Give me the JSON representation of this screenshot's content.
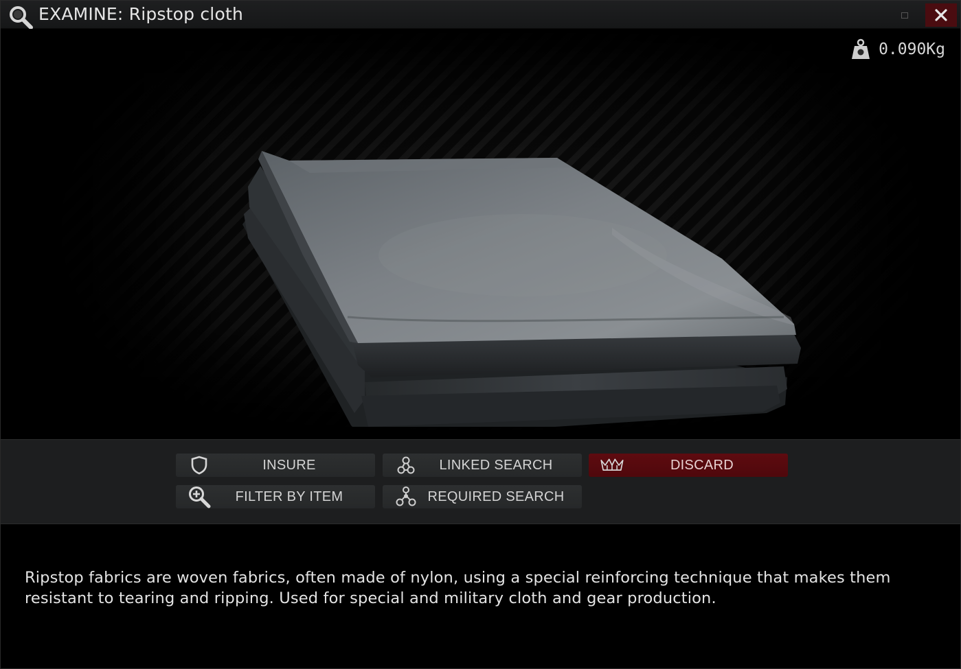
{
  "window": {
    "title": "EXAMINE: Ripstop cloth",
    "icons": {
      "title": "magnifier-icon",
      "minimize": "minimize-icon",
      "close": "close-icon"
    }
  },
  "preview": {
    "weight": "0.090Kg",
    "weight_icon": "weight-icon",
    "item_image": "ripstop-cloth-folded"
  },
  "actions": [
    {
      "label": "INSURE",
      "icon": "shield-icon"
    },
    {
      "label": "LINKED SEARCH",
      "icon": "linked-nodes-icon"
    },
    {
      "label": "DISCARD",
      "icon": "crown-discard-icon",
      "color": "#5a0a0e"
    },
    {
      "label": "FILTER BY ITEM",
      "icon": "zoom-plus-icon"
    },
    {
      "label": "REQUIRED SEARCH",
      "icon": "required-nodes-icon"
    }
  ],
  "description": "Ripstop fabrics are woven fabrics, often made of nylon, using a special reinforcing technique that makes them resistant to tearing and ripping. Used for special and military cloth and gear production.",
  "colors": {
    "accent_danger": "#5a0a0e",
    "close_button": "#4a0c10",
    "panel": "#1d1e1f"
  }
}
